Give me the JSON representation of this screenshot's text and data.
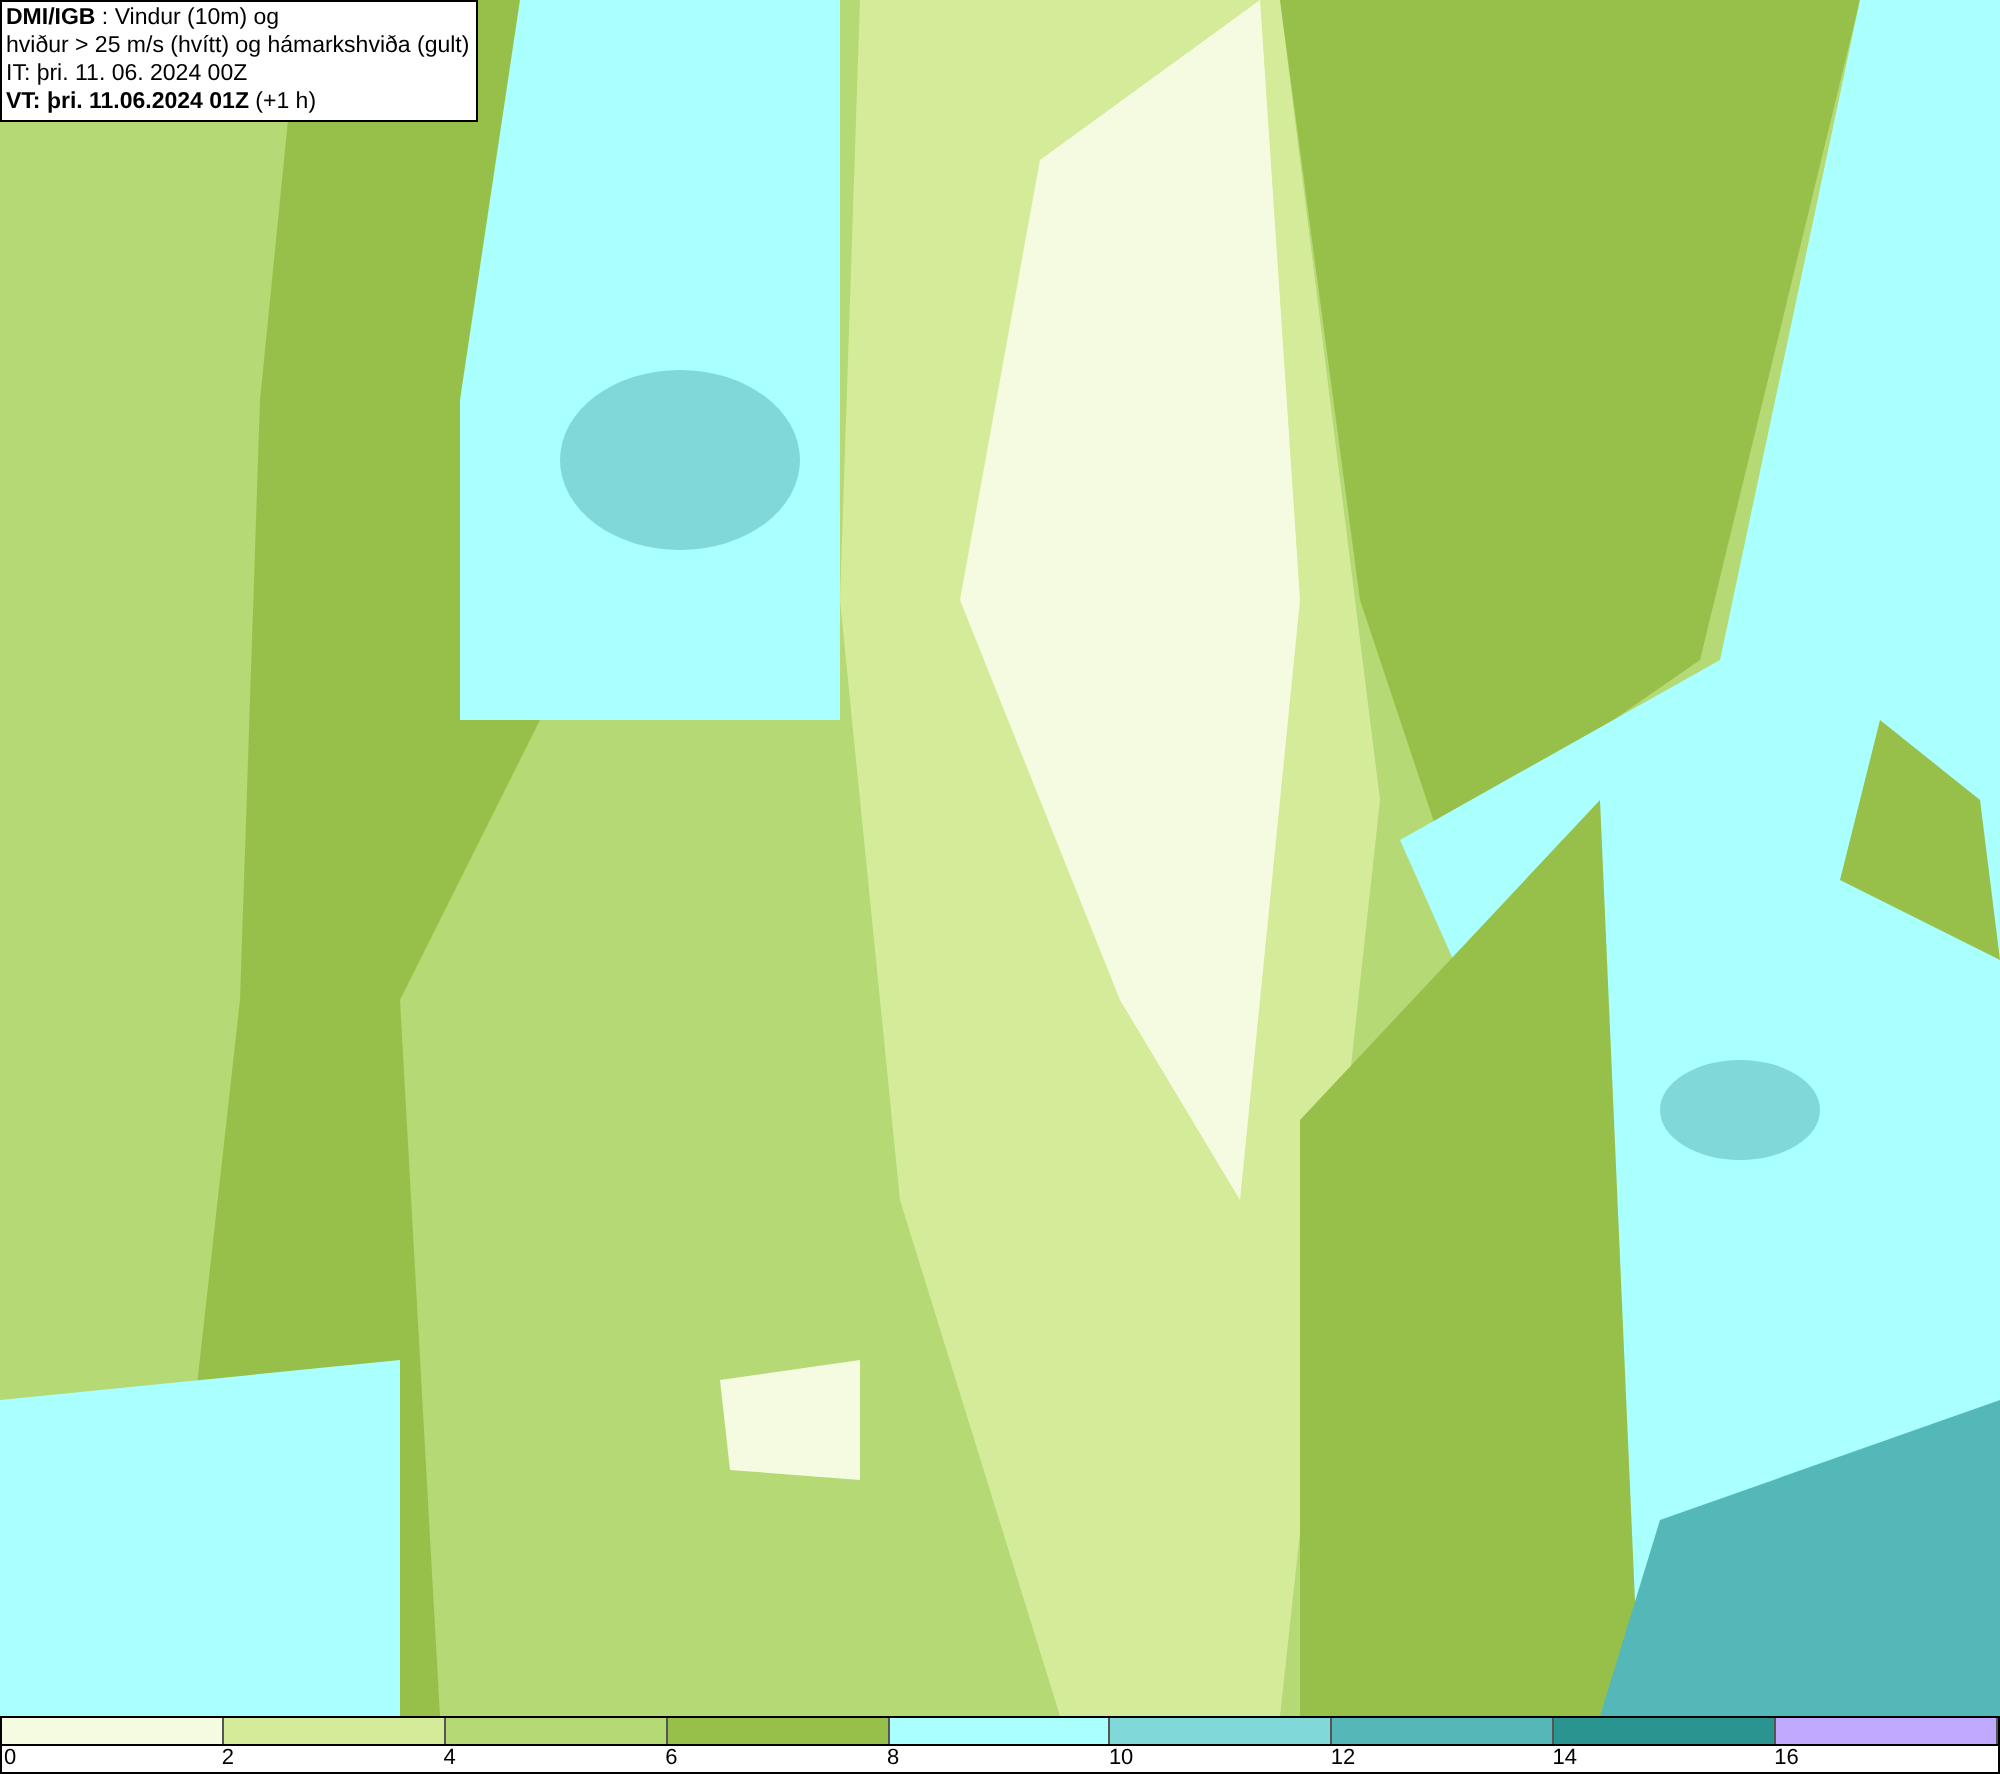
{
  "header": {
    "lines": [
      "**DMI/IGB** : Vindur (10m) og",
      "hviður > 25 m/s (hvítt) og hámarkshviða (gult)",
      "IT: þri. 11. 06. 2024 00Z",
      "**VT: þri. 11.06.2024 01Z** (+1 h)"
    ]
  },
  "legend": {
    "bins": [
      {
        "label": "0",
        "color": "#f5fbe0"
      },
      {
        "label": "2",
        "color": "#d4ec9a"
      },
      {
        "label": "4",
        "color": "#b5d975"
      },
      {
        "label": "6",
        "color": "#97c04a"
      },
      {
        "label": "8",
        "color": "#aaffff"
      },
      {
        "label": "10",
        "color": "#80d8d8"
      },
      {
        "label": "12",
        "color": "#55b8b8"
      },
      {
        "label": "14",
        "color": "#2a9590"
      },
      {
        "label": "16",
        "color": "#c0aaff"
      }
    ]
  }
}
